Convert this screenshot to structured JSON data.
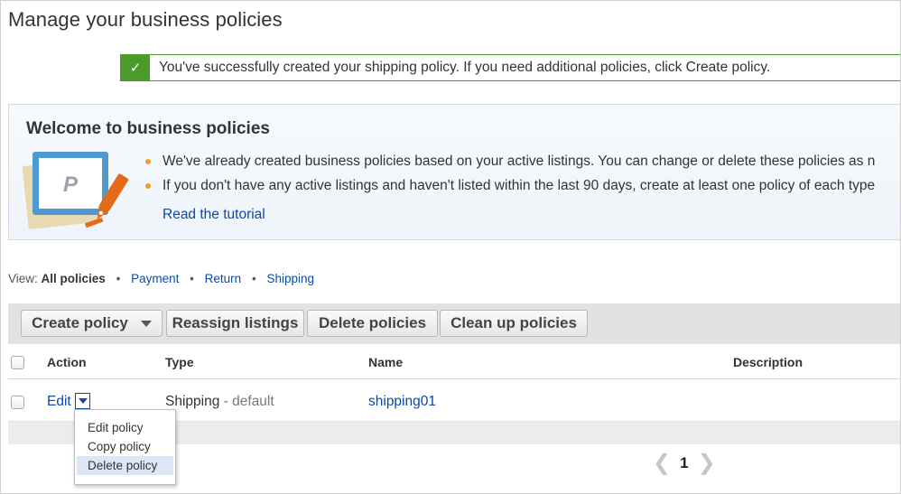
{
  "page": {
    "title": "Manage your business policies"
  },
  "success": {
    "check_icon": "check-icon",
    "message": "You've successfully created your shipping policy. If you need additional policies, click Create policy."
  },
  "welcome": {
    "title": "Welcome to business policies",
    "bullets": [
      "We've already created business policies based on your active listings. You can change or delete these policies as n",
      "If you don't have any active listings and haven't listed within the last 90 days, create at least one policy of each type"
    ],
    "tutorial_link": "Read the tutorial",
    "illustration_letter": "P"
  },
  "view": {
    "prefix": "View:",
    "active": "All policies",
    "links": [
      "Payment",
      "Return",
      "Shipping"
    ],
    "separator": "•"
  },
  "toolbar": {
    "create": "Create policy",
    "reassign": "Reassign listings",
    "delete": "Delete policies",
    "cleanup": "Clean up policies"
  },
  "table": {
    "headers": {
      "action": "Action",
      "type": "Type",
      "name": "Name",
      "description": "Description"
    },
    "rows": [
      {
        "action": "Edit",
        "type": "Shipping",
        "type_suffix": " - default",
        "name": "shipping01",
        "description": ""
      }
    ]
  },
  "menu": {
    "items": [
      "Edit policy",
      "Copy policy",
      "Delete policy"
    ],
    "highlighted": "Delete policy"
  },
  "pager": {
    "prev": "❮",
    "current": "1",
    "next": "❯"
  },
  "colors": {
    "success_green": "#4c9a2a",
    "link_blue": "#0a4ba6",
    "bullet_orange": "#f19d24",
    "toolbar_gray": "#e2e2e2"
  }
}
